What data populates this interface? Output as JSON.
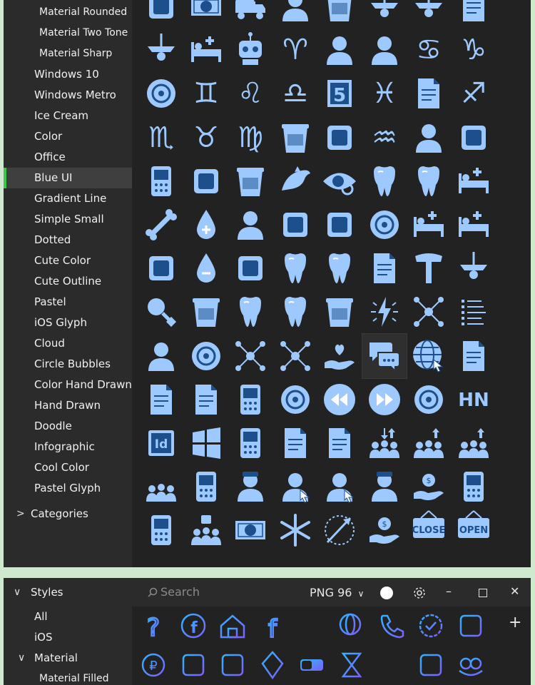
{
  "window1": {
    "sidebar": {
      "items": [
        {
          "label": "Material Rounded",
          "level": 2
        },
        {
          "label": "Material Two Tone",
          "level": 2
        },
        {
          "label": "Material Sharp",
          "level": 2
        },
        {
          "label": "Windows 10",
          "level": 1
        },
        {
          "label": "Windows Metro",
          "level": 1
        },
        {
          "label": "Ice Cream",
          "level": 1
        },
        {
          "label": "Color",
          "level": 1
        },
        {
          "label": "Office",
          "level": 1
        },
        {
          "label": "Blue UI",
          "level": 1,
          "active": true
        },
        {
          "label": "Gradient Line",
          "level": 1
        },
        {
          "label": "Simple Small",
          "level": 1
        },
        {
          "label": "Dotted",
          "level": 1
        },
        {
          "label": "Cute Color",
          "level": 1
        },
        {
          "label": "Cute Outline",
          "level": 1
        },
        {
          "label": "Pastel",
          "level": 1
        },
        {
          "label": "iOS Glyph",
          "level": 1
        },
        {
          "label": "Cloud",
          "level": 1
        },
        {
          "label": "Circle Bubbles",
          "level": 1
        },
        {
          "label": "Color Hand Drawn",
          "level": 1
        },
        {
          "label": "Hand Drawn",
          "level": 1
        },
        {
          "label": "Doodle",
          "level": 1
        },
        {
          "label": "Infographic",
          "level": 1
        },
        {
          "label": "Cool Color",
          "level": 1
        },
        {
          "label": "Pastel Glyph",
          "level": 1
        }
      ],
      "categories_label": "Categories"
    },
    "icons": [
      "inbox-tray-icon",
      "money-bill-icon",
      "dump-truck-icon",
      "office-worker-icon",
      "cap-icon",
      "ceiling-fan-icon",
      "ceiling-fan-light-icon",
      "newspaper-icon",
      "ceiling-lamp-icon",
      "hospital-bed-icon",
      "robot-icon",
      "aries-icon",
      "man-avatar-icon",
      "woman-avatar-icon",
      "cancer-zodiac-icon",
      "capricorn-icon",
      "sun-lamp-icon",
      "gemini-icon",
      "leo-icon",
      "libra-icon",
      "five-box-icon",
      "pisces-icon",
      "folder-lock-icon",
      "sagittarius-icon",
      "scorpio-icon",
      "taurus-icon",
      "virgo-icon",
      "trash-bin-icon",
      "accessibility-settings-icon",
      "aquarius-icon",
      "bathtub-person-icon",
      "rope-bridge-icon",
      "baby-monitor-icon",
      "corset-icon",
      "bucket-hat-icon",
      "dolphin-icon",
      "eye-search-icon",
      "electric-toothbrush-icon",
      "tooth-box-icon",
      "beach-chair-icon",
      "bone-icon",
      "blood-drop-plus-icon",
      "person-icon",
      "spray-bottle-icon",
      "flask-icon",
      "bacteria-icon",
      "hospital-bed-plus-icon",
      "stretcher-icon",
      "first-aid-kit-icon",
      "blood-drop-minus-icon",
      "garden-sprinkler-icon",
      "tooth-braces-icon",
      "broken-tooth-icon",
      "document-fold-icon",
      "hammer-icon",
      "wall-lamp-icon",
      "magnifier-icon",
      "plant-pot-icon",
      "tooth-icon",
      "tooth-icon-2",
      "pot-icon",
      "lightning-icon",
      "org-chart-icon",
      "list-icon",
      "face-scan-icon",
      "target-icon",
      "network-icon",
      "box-network-icon",
      "heart-hand-icon",
      "chat-bubbles-icon",
      "globe-cursor-icon",
      "file-export-icon",
      "file-import-icon",
      "excel-icon",
      "speaker-icon",
      "sea-sphere-icon",
      "rewind-icon",
      "fast-forward-icon",
      "magic-8-ball-icon",
      "hn-text-icon",
      "indesign-icon",
      "windows-logo-icon",
      "iphone-icon",
      "artboard-icon",
      "contacts-icon",
      "group-down-icon",
      "group-up-icon",
      "group-icon",
      "meeting-icon",
      "calendar-eye-icon",
      "police-officer-icon",
      "user-cursor-icon",
      "users-cursor-icon",
      "police-cap-icon",
      "hand-coin-icon",
      "mobile-dollar-icon",
      "calculator-dollar-icon",
      "vote-people-icon",
      "money-heart-icon",
      "asterisk-icon",
      "compass-arrow-icon",
      "money-hand-icon",
      "close-sign-icon",
      "open-sign-icon"
    ],
    "selected_icon_index": 69,
    "texts": {
      "close_sign": "CLOSE",
      "open_sign": "OPEN",
      "hn_text": "HN",
      "five": "5",
      "indesign": "Id"
    }
  },
  "window2": {
    "sidebar": {
      "styles_label": "Styles",
      "items": [
        {
          "label": "All",
          "level": 1
        },
        {
          "label": "iOS",
          "level": 1
        },
        {
          "label": "Material",
          "level": 1,
          "expanded": true
        },
        {
          "label": "Material Filled",
          "level": 2
        }
      ]
    },
    "toolbar": {
      "search_placeholder": "Search",
      "format_label": "PNG 96",
      "color_swatch": "#ffffff"
    },
    "icons": [
      "question-mark-icon",
      "facebook-circle-icon",
      "house-icon",
      "facebook-icon",
      "checklist-icon",
      "globe-cursor-icon",
      "phone-call-icon",
      "verified-badge-icon",
      "finder-icon",
      "ruble-coin-icon",
      "swimsuit-icon",
      "ceiling-fan-icon",
      "kite-icon",
      "toggle-icon",
      "hourglass-icon",
      "menu-lines-icon",
      "hand-pointer-icon",
      "monster-eyes-icon"
    ],
    "add_label": "+"
  },
  "colors": {
    "accent": "#3cc94a",
    "icon_fill": "#9ec9ff",
    "icon_dark": "#1c4f8c",
    "gradient_a": "#7b61ff",
    "gradient_b": "#2fb5ff",
    "bg": "#2b2b2b",
    "grid_bg": "#222222"
  }
}
